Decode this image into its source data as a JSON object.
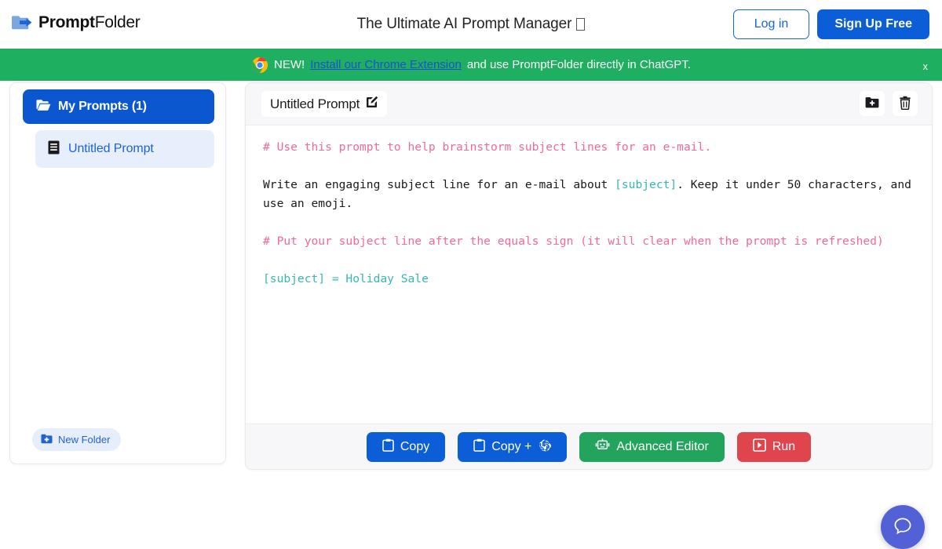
{
  "header": {
    "logo_bold": "Prompt",
    "logo_light": "Folder",
    "logo_icon": "folder-arrow-icon",
    "tagline": "The Ultimate AI Prompt Manager",
    "tagline_trailing_glyph": "missing-glyph-box",
    "login_label": "Log in",
    "signup_label": "Sign Up Free"
  },
  "banner": {
    "icon": "chrome-icon",
    "prefix": "NEW!",
    "link_text": "Install our Chrome Extension",
    "suffix": "and use PromptFolder directly in ChatGPT.",
    "close_label": "x",
    "background_color": "#1eaf60",
    "link_color": "#1f4fd8"
  },
  "sidebar": {
    "folder": {
      "label": "My Prompts (1)",
      "icon": "open-folder-icon",
      "selected": true,
      "color": "#0b57d0"
    },
    "items": [
      {
        "label": "Untitled Prompt",
        "icon": "document-icon",
        "selected": true
      }
    ],
    "new_folder_label": "New Folder",
    "new_folder_icon": "folder-plus-icon"
  },
  "prompt_card": {
    "title": "Untitled Prompt",
    "title_edit_icon": "pencil-square-icon",
    "add_to_folder_icon": "folder-plus-icon",
    "delete_icon": "trash-icon",
    "content_lines": [
      {
        "type": "comment",
        "text": "# Use this prompt to help brainstorm subject lines for an e-mail."
      },
      {
        "type": "blank",
        "text": ""
      },
      {
        "type": "mixed",
        "segments": [
          {
            "style": "text",
            "text": "Write an engaging subject line for an e-mail about "
          },
          {
            "style": "var",
            "text": "[subject]"
          },
          {
            "style": "text",
            "text": ". Keep it under 50 characters, and use an emoji."
          }
        ]
      },
      {
        "type": "blank",
        "text": ""
      },
      {
        "type": "comment",
        "text": "# Put your subject line after the equals sign (it will clear when the prompt is refreshed)"
      },
      {
        "type": "blank",
        "text": ""
      },
      {
        "type": "var",
        "text": "[subject] = Holiday Sale"
      }
    ],
    "colors": {
      "comment": "#f2699c",
      "variable": "#37b7b4",
      "text": "#1a1a1a"
    },
    "actions": [
      {
        "label": "Copy",
        "icon": "clipboard-icon",
        "color": "#0b5ed7",
        "variant": "blue"
      },
      {
        "label": "Copy +",
        "icon": "clipboard-openai-icon",
        "color": "#0b5ed7",
        "variant": "blue"
      },
      {
        "label": "Advanced Editor",
        "icon": "robot-icon",
        "color": "#22a45d",
        "variant": "green"
      },
      {
        "label": "Run",
        "icon": "play-box-icon",
        "color": "#e0444d",
        "variant": "red"
      }
    ]
  },
  "help_widget": {
    "icon": "chat-bubble-icon",
    "color": "#5262d6"
  }
}
